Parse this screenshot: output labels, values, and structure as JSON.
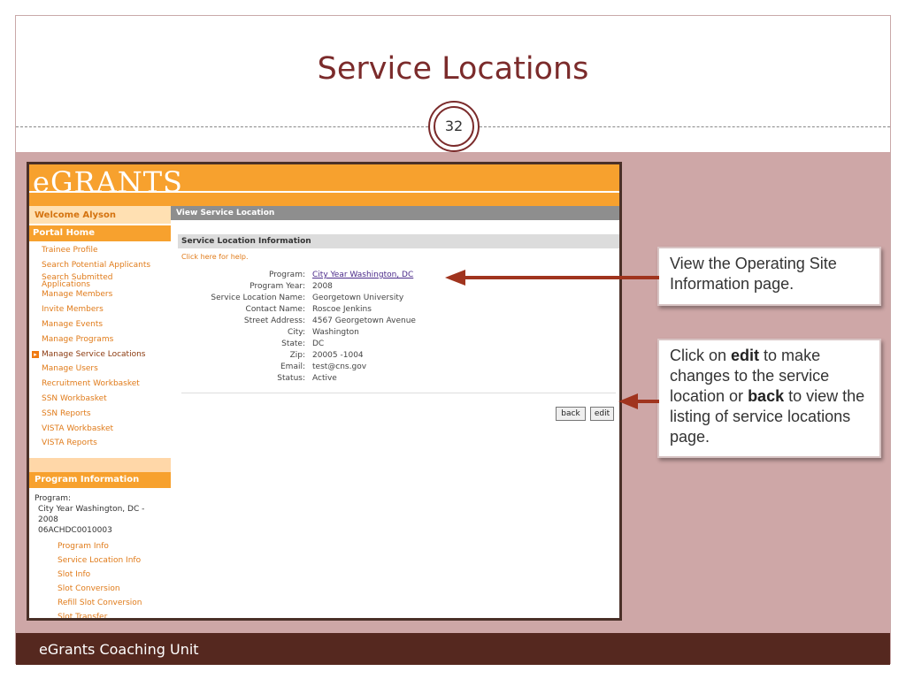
{
  "slide": {
    "title": "Service Locations",
    "slide_number": "32",
    "footer": "eGrants Coaching Unit"
  },
  "app": {
    "logo": "eGRANTS",
    "welcome": "Welcome Alyson",
    "portal_home": "Portal Home",
    "nav_items": [
      "Trainee Profile",
      "Search Potential Applicants",
      "Search Submitted Applications",
      "Manage Members",
      "Invite Members",
      "Manage Events",
      "Manage Programs",
      "Manage Service Locations",
      "Manage Users",
      "Recruitment Workbasket",
      "SSN Workbasket",
      "SSN Reports",
      "VISTA Workbasket",
      "VISTA Reports"
    ],
    "active_nav": "Manage Service Locations",
    "program_info": {
      "title": "Program Information",
      "program_label": "Program:",
      "program_name": "City Year Washington, DC - 2008",
      "program_code": "06ACHDC0010003",
      "links": [
        "Program Info",
        "Service Location Info",
        "Slot Info",
        "Slot Conversion",
        "Refill Slot Conversion",
        "Slot Transfer"
      ]
    },
    "main_header": "View Service Location",
    "panel_title": "Service Location Information",
    "help_link": "Click here for help.",
    "fields": [
      {
        "label": "Program:",
        "value": "City Year Washington, DC",
        "link": true
      },
      {
        "label": "Program Year:",
        "value": "2008"
      },
      {
        "label": "Service Location Name:",
        "value": "Georgetown University"
      },
      {
        "label": "Contact Name:",
        "value": "Roscoe Jenkins"
      },
      {
        "label": "Street Address:",
        "value": "4567 Georgetown Avenue"
      },
      {
        "label": "City:",
        "value": "Washington"
      },
      {
        "label": "State:",
        "value": "DC"
      },
      {
        "label": "Zip:",
        "value": "20005 -1004"
      },
      {
        "label": "Email:",
        "value": "test@cns.gov"
      },
      {
        "label": "Status:",
        "value": "Active"
      }
    ],
    "buttons": {
      "back": "back",
      "edit": "edit"
    }
  },
  "callouts": {
    "first": "View the Operating Site Information page.",
    "second": {
      "t1": "Click on ",
      "b1": "edit",
      "t2": " to make changes to the service location or ",
      "b2": "back",
      "t3": " to view the listing of service locations page."
    }
  },
  "colors": {
    "title": "#7b2b2b",
    "arrow": "#a0341e",
    "orange": "#f7a12e",
    "footer": "#55281f",
    "pink": "#cea7a7"
  }
}
